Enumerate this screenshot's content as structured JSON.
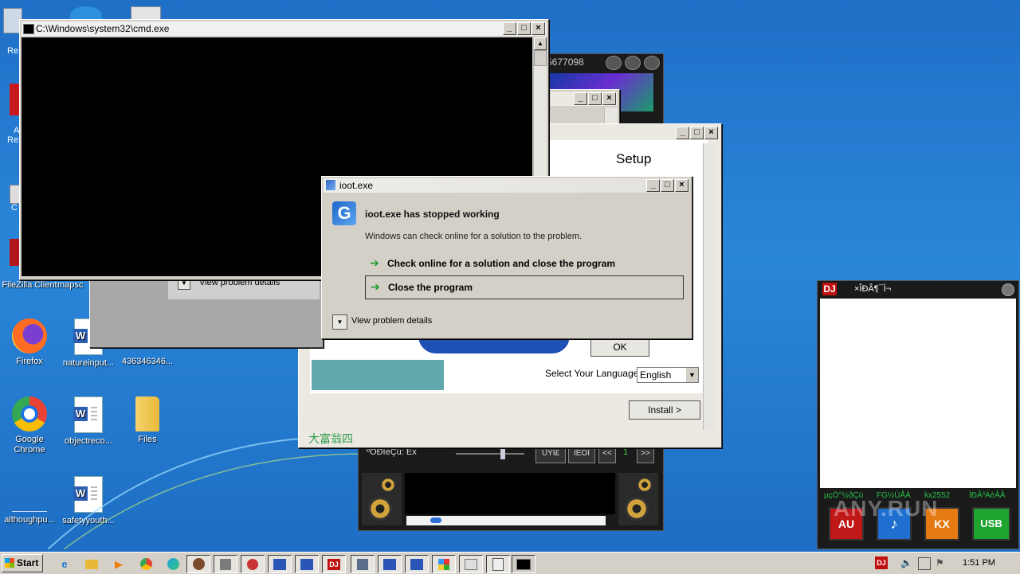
{
  "desktop": {
    "icons": [
      {
        "label": "FileZilla Client"
      },
      {
        "label": "mapsc"
      },
      {
        "label": "Firefox"
      },
      {
        "label": "natureinput..."
      },
      {
        "label": "436346346..."
      },
      {
        "label": "Google Chrome"
      },
      {
        "label": "objectreco..."
      },
      {
        "label": "Files"
      },
      {
        "label": "althoughpu..."
      },
      {
        "label": "safetyyouth..."
      }
    ],
    "left_clipped": [
      "Re",
      "A",
      "Re",
      "C"
    ]
  },
  "cmd_window": {
    "title": "C:\\Windows\\system32\\cmd.exe"
  },
  "player": {
    "id_text": "5677098",
    "status_text": "ºÔÐÎèÇú: Êx",
    "btn1": "ÛÝÌ£",
    "btn2": "ÌÉÓÌ",
    "prev": "<<",
    "next": ">>",
    "page_num": "1",
    "banner_text": "大富翁四"
  },
  "behind_window": {
    "view_details": "View problem details"
  },
  "setup_window": {
    "heading": "Setup",
    "ok_label": "OK",
    "lang_label": "Select Your Language:",
    "lang_value": "English",
    "install_label": "Install >"
  },
  "error_dialog": {
    "title": "ioot.exe",
    "heading": "ioot.exe has stopped working",
    "message": "Windows can check online for a solution to the problem.",
    "option1": "Check online for a solution and close the program",
    "option2": "Close the program",
    "details": "View problem details"
  },
  "dj_panel": {
    "logo": "DJ",
    "title": "×ÎÐÂ¶¯Ì¬",
    "footer_items": [
      "µçÓ°½ðÇú",
      "FG½ÚÅÄ",
      "kx2552",
      "ÌÐÂ³ÁèÂÂ"
    ],
    "big_buttons": [
      "AU",
      "♪",
      "KX",
      "USB"
    ],
    "watermark": "ANY.RUN"
  },
  "taskbar": {
    "start_label": "Start",
    "clock": "1:51 PM",
    "tray_dj": "DJ"
  }
}
